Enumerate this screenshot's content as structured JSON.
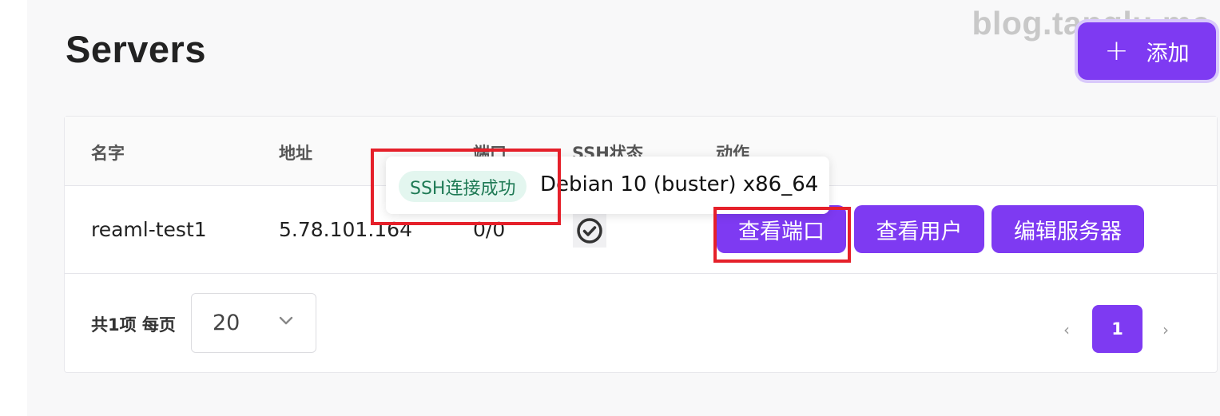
{
  "page": {
    "title": "Servers"
  },
  "watermark": "blog.tanglu.me",
  "toolbar": {
    "add_icon": "+",
    "add_label": "添加"
  },
  "table": {
    "columns": [
      "名字",
      "地址",
      "端口",
      "SSH状态",
      "动作"
    ],
    "rows": [
      {
        "name": "reaml-test1",
        "address": "5.78.101.164",
        "port": "0/0",
        "ssh_status_icon": "check-circle-icon",
        "actions": [
          "查看端口",
          "查看用户",
          "编辑服务器"
        ]
      }
    ]
  },
  "footer": {
    "total_label": "共1项 每页",
    "page_size": "20",
    "current_page": "1",
    "prev_icon": "‹",
    "next_icon": "›"
  },
  "tooltip": {
    "status_tag": "SSH连接成功",
    "os_info": "Debian 10 (buster) x86_64"
  },
  "colors": {
    "accent": "#7e3af2",
    "success_bg": "#e3f6ef",
    "success_text": "#1f7a55",
    "highlight": "#e5202a"
  }
}
